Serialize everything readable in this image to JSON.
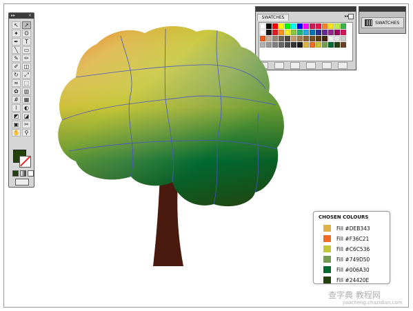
{
  "swatches_panel": {
    "tab_label": "SWATCHES",
    "swatch_colors": [
      "#ffffff",
      "#000000",
      "#ff0000",
      "#ffff00",
      "#00ff00",
      "#00ffff",
      "#0000ff",
      "#ff00ff",
      "#c81e50",
      "#e6194b",
      "#f58231",
      "#ffe119",
      "#bfef45",
      "#3cb44b",
      "#ffffff",
      "#1a1a1a",
      "#e31b23",
      "#f7931e",
      "#fcee21",
      "#8cc63f",
      "#22b573",
      "#29abe2",
      "#0071bc",
      "#2e3192",
      "#662d91",
      "#93278f",
      "#9e005d",
      "#d4145a",
      "#f15a24",
      "#c7b299",
      "#998675",
      "#736357",
      "#534741",
      "#c69c6d",
      "#a67c52",
      "#8c6239",
      "#754c24",
      "#603813",
      "#42210b",
      "#f2f2f2",
      "#e6e6e6",
      "#cccccc",
      "#b3b3b3",
      "#999999",
      "#808080",
      "#666666",
      "#4d4d4d",
      "#333333",
      "#1a1a1a",
      "#DEB343",
      "#F36C21",
      "#C6C536",
      "#749D50",
      "#006A30",
      "#24420E",
      "#6b4226"
    ]
  },
  "collapsed_panel": {
    "label": "SWATCHES"
  },
  "chosen_colours": {
    "title": "CHOSEN COLOURS",
    "items": [
      {
        "label": "Fill  #DEB343",
        "color": "#DEB343"
      },
      {
        "label": "Fill  #F36C21",
        "color": "#F36C21"
      },
      {
        "label": "Fill  #C6C536",
        "color": "#C6C536"
      },
      {
        "label": "Fill  #749D50",
        "color": "#749D50"
      },
      {
        "label": "Fill  #006A30",
        "color": "#006A30"
      },
      {
        "label": "Fill  #24420E",
        "color": "#24420E"
      }
    ]
  },
  "toolbar": {
    "tools": [
      "selection-tool",
      "direct-selection-tool",
      "magic-wand-tool",
      "lasso-tool",
      "pen-tool",
      "type-tool",
      "line-tool",
      "rectangle-tool",
      "paintbrush-tool",
      "pencil-tool",
      "blob-brush-tool",
      "eraser-tool",
      "rotate-tool",
      "scale-tool",
      "warp-tool",
      "free-transform-tool",
      "symbol-sprayer-tool",
      "column-graph-tool",
      "mesh-tool",
      "gradient-tool",
      "eyedropper-tool",
      "blend-tool",
      "live-paint-tool",
      "live-paint-selection-tool",
      "artboard-tool",
      "slice-tool",
      "hand-tool",
      "zoom-tool"
    ],
    "glyphs": [
      "↖",
      "↗",
      "✦",
      "ʘ",
      "✒",
      "T",
      "╲",
      "▭",
      "✎",
      "✏",
      "✐",
      "◫",
      "↻",
      "⤢",
      "≈",
      "⬚",
      "✿",
      "▥",
      "#",
      "▦",
      "⌇",
      "◐",
      "◩",
      "◪",
      "▣",
      "✂",
      "✋",
      "⚲"
    ],
    "fill_color": "#24420E"
  },
  "watermark": {
    "text": "查字典 教程网",
    "subtext": "jiaocheng.chazidian.com"
  }
}
